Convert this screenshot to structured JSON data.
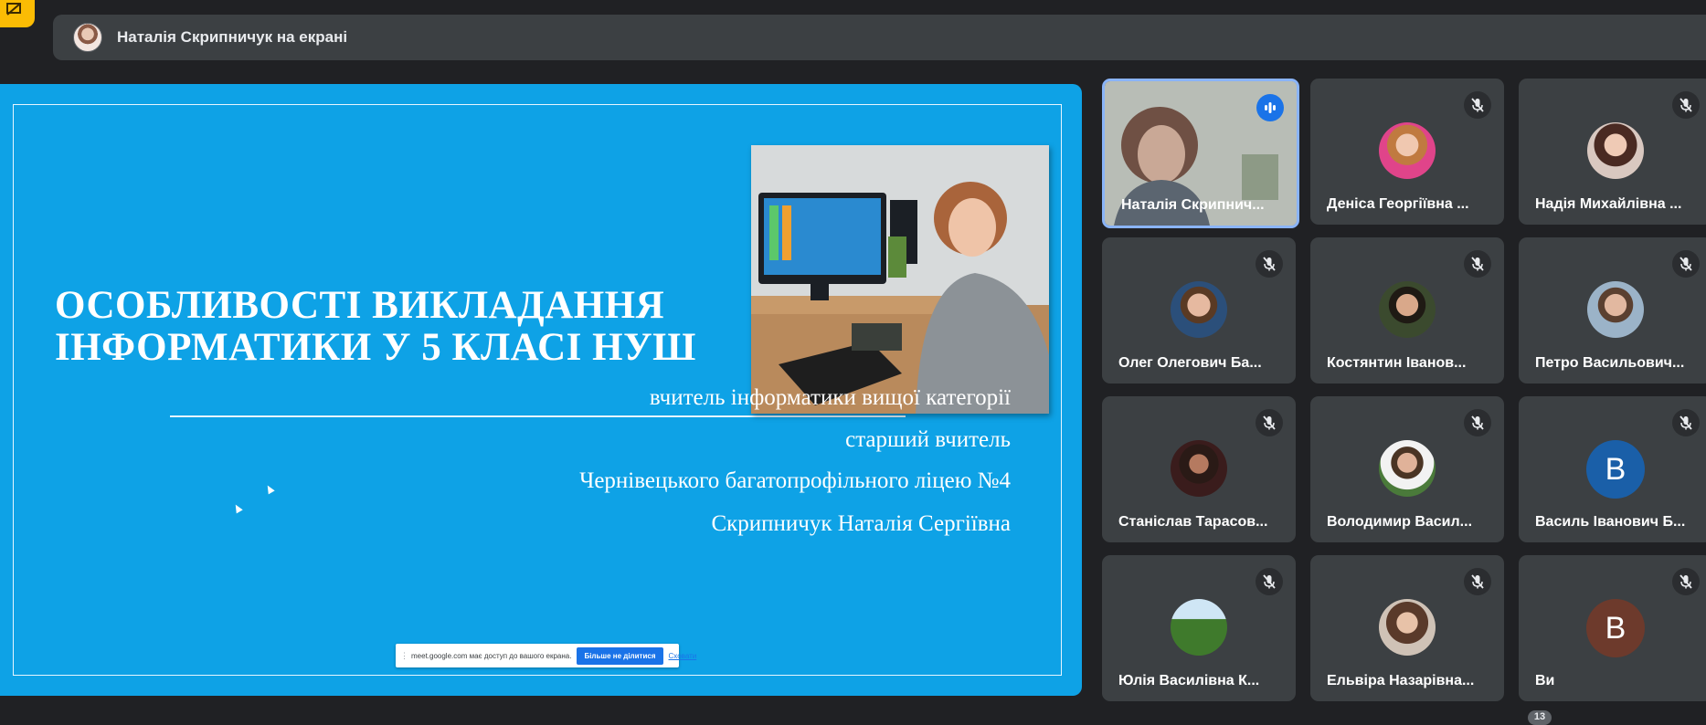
{
  "topbar": {
    "presenter_label": "Наталія Скрипничук на екрані"
  },
  "slide": {
    "title_line1": "ОСОБЛИВОСТІ ВИКЛАДАННЯ",
    "title_line2": "ІНФОРМАТИКИ У 5 КЛАСІ НУШ",
    "lines": [
      "вчитель інформатики вищої категорії",
      "старший вчитель",
      "Чернівецького багатопрофільного ліцею №4",
      "Скрипничук Наталія Сергіївна"
    ]
  },
  "share_bar": {
    "message": "meet.google.com має доступ до вашого екрана.",
    "stop_label": "Більше не ділитися",
    "hide_label": "Сховати"
  },
  "participants": [
    {
      "name": "Наталія Скрипнич...",
      "speaking": true
    },
    {
      "name": "Деніса Георгіївна ..."
    },
    {
      "name": "Надія Михайлівна ..."
    },
    {
      "name": "Олег Олегович Ба..."
    },
    {
      "name": "Костянтин Іванов..."
    },
    {
      "name": "Петро Васильович..."
    },
    {
      "name": "Станіслав Тарасов..."
    },
    {
      "name": "Володимир Васил..."
    },
    {
      "name": "Василь Іванович Б...",
      "initial": "В",
      "color": "#1a5fa8"
    },
    {
      "name": "Юлія Василівна К..."
    },
    {
      "name": "Ельвіра Назарівна..."
    },
    {
      "name": "Ви",
      "initial": "В",
      "color": "#6d3a2c"
    }
  ],
  "overflow_count": "13",
  "colors": {
    "background": "#202124",
    "tile": "#3c4043",
    "stage": "#0ea2e6",
    "accent": "#1a73e8"
  }
}
